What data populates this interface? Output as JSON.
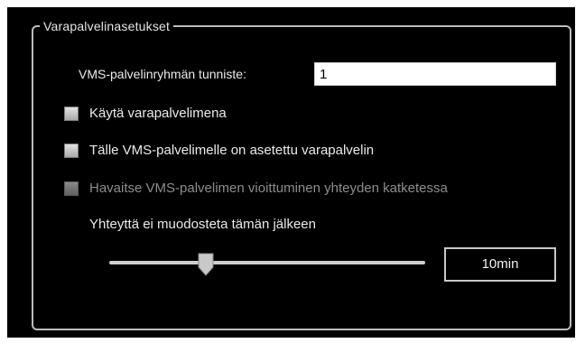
{
  "group": {
    "title": "Varapalvelinasetukset"
  },
  "server_group_id": {
    "label": "VMS-palvelinryhmän tunniste:",
    "value": "1"
  },
  "checkboxes": [
    {
      "label": "Käytä varapalvelimena",
      "checked": false,
      "enabled": true
    },
    {
      "label": "Tälle VMS-palvelimelle on asetettu varapalvelin",
      "checked": false,
      "enabled": true
    },
    {
      "label": "Havaitse VMS-palvelimen vioittuminen yhteyden katketessa",
      "checked": false,
      "enabled": false
    }
  ],
  "reconnect": {
    "label": "Yhteyttä ei muodosteta tämän jälkeen",
    "value": "10min",
    "slider_level": 0.3
  },
  "colors": {
    "background": "#000000",
    "text": "#eaeaea",
    "disabled_text": "#8c8c8c",
    "border": "#bcbcbc"
  }
}
